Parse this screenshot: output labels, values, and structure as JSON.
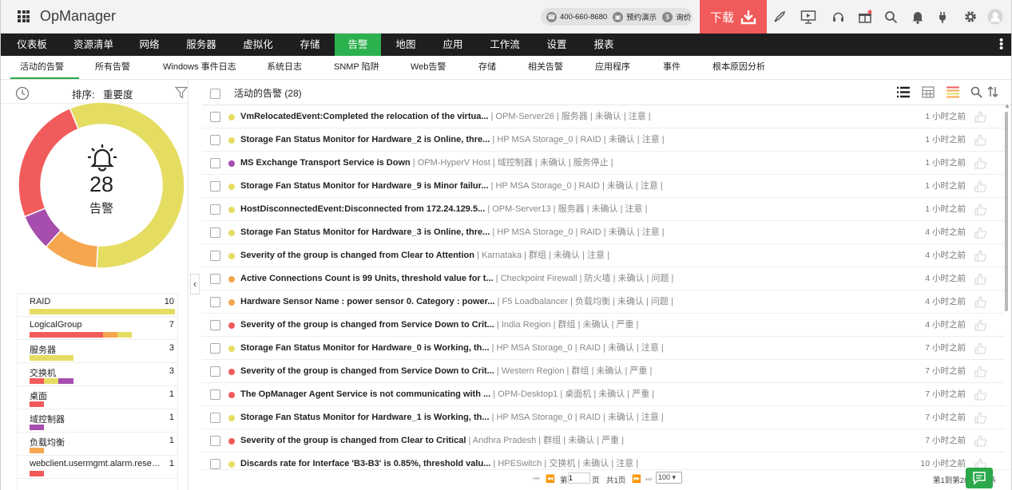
{
  "header": {
    "logo": "OpManager",
    "phone": "400-660-8680",
    "demo": "预约演示",
    "quote": "询价",
    "download": "下载"
  },
  "nav": [
    "仪表板",
    "资源清单",
    "网络",
    "服务器",
    "虚拟化",
    "存储",
    "告警",
    "地图",
    "应用",
    "工作流",
    "设置",
    "报表"
  ],
  "active_nav": "告警",
  "subnav": [
    "活动的告警",
    "所有告警",
    "Windows 事件日志",
    "系统日志",
    "SNMP 陷阱",
    "Web告警",
    "存储",
    "相关告警",
    "应用程序",
    "事件",
    "根本原因分析"
  ],
  "left": {
    "sort_label": "排序:",
    "sort_value": "重要度",
    "total": "28",
    "total_label": "告警",
    "categories": [
      {
        "name": "RAID",
        "count": "10"
      },
      {
        "name": "LogicalGroup",
        "count": "7"
      },
      {
        "name": "服务器",
        "count": "3"
      },
      {
        "name": "交换机",
        "count": "3"
      },
      {
        "name": "桌面",
        "count": "1"
      },
      {
        "name": "域控制器",
        "count": "1"
      },
      {
        "name": "负载均衡",
        "count": "1"
      },
      {
        "name": "webclient.usermgmt.alarm.reset...",
        "count": "1"
      }
    ]
  },
  "list": {
    "title": "活动的告警 (28)",
    "rows": [
      {
        "msg": "VmRelocatedEvent:Completed the relocation of the virtua...",
        "meta": " | OPM-Server26 | 服务器 | 未确认 | 注意 |",
        "time": "1 小时之前",
        "sev": "yellow"
      },
      {
        "msg": "Storage Fan Status Monitor for Hardware_2 is Online, thre...",
        "meta": " | HP MSA Storage_0 | RAID | 未确认 | 注意 |",
        "time": "1 小时之前",
        "sev": "yellow"
      },
      {
        "msg": "MS Exchange Transport Service is Down",
        "meta": " | OPM-HyperV Host | 域控制器 | 未确认 | 服务停止 |",
        "time": "1 小时之前",
        "sev": "purple"
      },
      {
        "msg": "Storage Fan Status Monitor for Hardware_9 is Minor failur...",
        "meta": " | HP MSA Storage_0 | RAID | 未确认 | 注意 |",
        "time": "1 小时之前",
        "sev": "yellow"
      },
      {
        "msg": "HostDisconnectedEvent:Disconnected from 172.24.129.5...",
        "meta": " | OPM-Server13 | 服务器 | 未确认 | 注意 |",
        "time": "1 小时之前",
        "sev": "yellow"
      },
      {
        "msg": "Storage Fan Status Monitor for Hardware_3 is Online, thre...",
        "meta": " | HP MSA Storage_0 | RAID | 未确认 | 注意 |",
        "time": "4 小时之前",
        "sev": "yellow"
      },
      {
        "msg": "Severity of the group is changed from Clear to Attention",
        "meta": " | Karnataka | 群组 | 未确认 | 注意 |",
        "time": "4 小时之前",
        "sev": "yellow"
      },
      {
        "msg": "Active Connections Count is 99 Units, threshold value for t...",
        "meta": " | Checkpoint Firewall | 防火墙 | 未确认 | 问题 |",
        "time": "4 小时之前",
        "sev": "orange"
      },
      {
        "msg": "Hardware Sensor Name : power sensor 0. Category : power...",
        "meta": " | F5 Loadbalancer | 负载均衡 | 未确认 | 问题 |",
        "time": "4 小时之前",
        "sev": "orange"
      },
      {
        "msg": "Severity of the group is changed from Service Down to Crit...",
        "meta": " | India Region | 群组 | 未确认 | 严重 |",
        "time": "4 小时之前",
        "sev": "red"
      },
      {
        "msg": "Storage Fan Status Monitor for Hardware_0 is Working, th...",
        "meta": " | HP MSA Storage_0 | RAID | 未确认 | 注意 |",
        "time": "7 小时之前",
        "sev": "yellow"
      },
      {
        "msg": "Severity of the group is changed from Service Down to Crit...",
        "meta": " | Western Region | 群组 | 未确认 | 严重 |",
        "time": "7 小时之前",
        "sev": "red"
      },
      {
        "msg": "The OpManager Agent Service is not communicating with ...",
        "meta": " | OPM-Desktop1 | 桌面机 | 未确认 | 严重 |",
        "time": "7 小时之前",
        "sev": "red"
      },
      {
        "msg": "Storage Fan Status Monitor for Hardware_1 is Working, th...",
        "meta": " | HP MSA Storage_0 | RAID | 未确认 | 注意 |",
        "time": "7 小时之前",
        "sev": "yellow"
      },
      {
        "msg": "Severity of the group is changed from Clear to Critical",
        "meta": " | Andhra Pradesh | 群组 | 未确认 | 严重 |",
        "time": "7 小时之前",
        "sev": "red"
      },
      {
        "msg": "Discards rate for Interface 'B3-B3' is 0.85%, threshold valu...",
        "meta": " | HPESwitch | 交换机 | 未确认 | 注意 |",
        "time": "10 小时之前",
        "sev": "yellow"
      }
    ]
  },
  "pager": {
    "page_prefix": "第",
    "page_value": "1",
    "page_suffix": "页",
    "total_pages": "共1页",
    "per_page": "100",
    "summary": "第1到第28 共28 条"
  },
  "colors": {
    "red": "#f25b5b",
    "yellow": "#e4dd62",
    "orange": "#f6a64e",
    "purple": "#a64dae",
    "green": "#2cb14f"
  }
}
